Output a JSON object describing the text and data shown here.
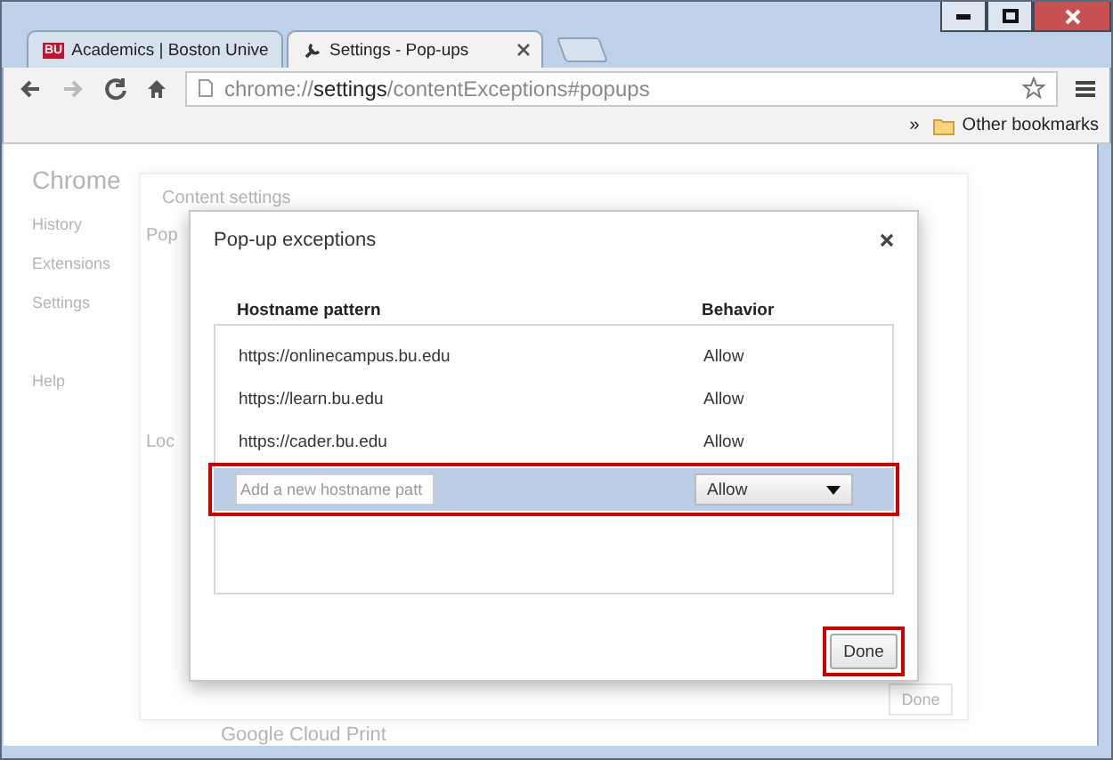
{
  "tabs": [
    {
      "title": "Academics | Boston Unive",
      "favicon_text": "BU",
      "selected": false
    },
    {
      "title": "Settings - Pop-ups",
      "selected": true
    }
  ],
  "address": {
    "scheme": "chrome://",
    "host": "settings",
    "path": "/contentExceptions#popups"
  },
  "bookmarks": {
    "overflow": "»",
    "folder": "Other bookmarks"
  },
  "background_page": {
    "title": "Chrome",
    "nav": [
      "History",
      "Extensions",
      "Settings",
      "Help"
    ],
    "dialog": {
      "title": "Content settings",
      "sections": [
        "Pop",
        "Loc"
      ],
      "button": "Done"
    },
    "footer": "Google Cloud Print"
  },
  "dialog": {
    "title": "Pop-up exceptions",
    "columns": [
      "Hostname pattern",
      "Behavior"
    ],
    "rows": [
      {
        "host": "https://onlinecampus.bu.edu",
        "behavior": "Allow"
      },
      {
        "host": "https://learn.bu.edu",
        "behavior": "Allow"
      },
      {
        "host": "https://cader.bu.edu",
        "behavior": "Allow"
      }
    ],
    "new_row": {
      "placeholder": "Add a new hostname patt",
      "behavior": "Allow",
      "highlighted": true
    },
    "button": {
      "label": "Done",
      "highlighted": true
    }
  }
}
